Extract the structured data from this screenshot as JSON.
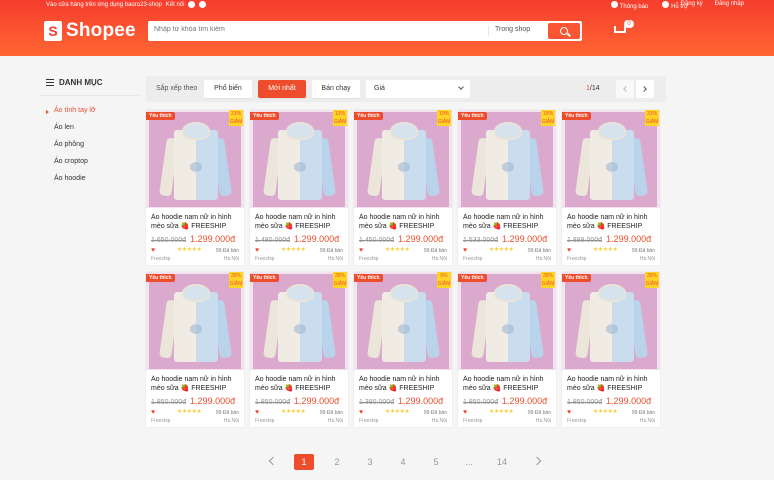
{
  "topbar": {
    "left_text": "Vào cửa hàng trên ứng dụng baoro23-shop",
    "connect": "Kết nối",
    "notifications": "Thông báo",
    "help": "Hỗ trợ",
    "register": "Đăng ký",
    "login": "Đăng nhập"
  },
  "header": {
    "logo_text": "Shopee",
    "search_placeholder": "Nhập từ khóa tìm kiếm",
    "search_scope": "Trong shop",
    "cart_count": "0"
  },
  "sidebar": {
    "title": "DANH MỤC",
    "items": [
      {
        "label": "Áo tình tay lỡ",
        "active": true
      },
      {
        "label": "Áo len"
      },
      {
        "label": "Áo phông"
      },
      {
        "label": "Áo croptop"
      },
      {
        "label": "Áo hoodie"
      }
    ]
  },
  "sortbar": {
    "label": "Sắp xếp theo",
    "options": [
      "Phổ biến",
      "Mới nhất",
      "Bán chạy"
    ],
    "active": "Mới nhất",
    "price_label": "Giá",
    "page_current": "1",
    "page_total": "/14"
  },
  "products": [
    {
      "name": "Áo hoodie nam nữ in hình mèo sữa 🍓 FREESHIP",
      "old_price": "1.650.000đ",
      "price": "1.299.000đ",
      "sold": "99 Đã bán",
      "badge": "Yêu thích",
      "discount": "21% GIẢM",
      "loc1": "Freeship",
      "loc2": "Hà Nội"
    },
    {
      "name": "Áo hoodie nam nữ in hình mèo sữa 🍓 FREESHIP",
      "old_price": "1.480.000đ",
      "price": "1.299.000đ",
      "sold": "99 Đã bán",
      "badge": "Yêu thích",
      "discount": "12% GIẢM",
      "loc1": "Freeship",
      "loc2": "Hà Nội"
    },
    {
      "name": "Áo hoodie nam nữ in hình mèo sữa 🍓 FREESHIP",
      "old_price": "1.450.000đ",
      "price": "1.299.000đ",
      "sold": "99 Đã bán",
      "badge": "Yêu thích",
      "discount": "10% GIẢM",
      "loc1": "Freeship",
      "loc2": "Hà Nội"
    },
    {
      "name": "Áo hoodie nam nữ in hình mèo sữa 🍓 FREESHIP",
      "old_price": "1.533.000đ",
      "price": "1.299.000đ",
      "sold": "99 Đã bán",
      "badge": "Yêu thích",
      "discount": "15% GIẢM",
      "loc1": "Freeship",
      "loc2": "Hà Nội"
    },
    {
      "name": "Áo hoodie nam nữ in hình mèo sữa 🍓 FREESHIP",
      "old_price": "1.888.000đ",
      "price": "1.299.000đ",
      "sold": "99 Đã bán",
      "badge": "Yêu thích",
      "discount": "31% GIẢM",
      "loc1": "Freeship",
      "loc2": "Hà Nội"
    },
    {
      "name": "Áo hoodie nam nữ in hình mèo sữa 🍓 FREESHIP",
      "old_price": "1.850.000đ",
      "price": "1.299.000đ",
      "sold": "99 Đã bán",
      "badge": "Yêu thích",
      "discount": "30% GIẢM",
      "loc1": "Freeship",
      "loc2": "Hà Nội"
    },
    {
      "name": "Áo hoodie nam nữ in hình mèo sữa 🍓 FREESHIP",
      "old_price": "1.850.000đ",
      "price": "1.299.000đ",
      "sold": "99 Đã bán",
      "badge": "Yêu thích",
      "discount": "30% GIẢM",
      "loc1": "Freeship",
      "loc2": "Hà Nội"
    },
    {
      "name": "Áo hoodie nam nữ in hình mèo sữa 🍓 FREESHIP",
      "old_price": "1.380.000đ",
      "price": "1.299.000đ",
      "sold": "99 Đã bán",
      "badge": "Yêu thích",
      "discount": "6% GIẢM",
      "loc1": "Freeship",
      "loc2": "Hà Nội"
    },
    {
      "name": "Áo hoodie nam nữ in hình mèo sữa 🍓 FREESHIP",
      "old_price": "1.850.000đ",
      "price": "1.299.000đ",
      "sold": "99 Đã bán",
      "badge": "Yêu thích",
      "discount": "30% GIẢM",
      "loc1": "Freeship",
      "loc2": "Hà Nội"
    },
    {
      "name": "Áo hoodie nam nữ in hình mèo sữa 🍓 FREESHIP",
      "old_price": "1.850.000đ",
      "price": "1.299.000đ",
      "sold": "99 Đã bán",
      "badge": "Yêu thích",
      "discount": "30% GIẢM",
      "loc1": "Freeship",
      "loc2": "Hà Nội"
    }
  ],
  "pagination": {
    "pages": [
      "1",
      "2",
      "3",
      "4",
      "5",
      "...",
      "14"
    ],
    "active": "1"
  },
  "colors": {
    "brand": "#ee4d2d",
    "header_gradient_top": "#f53d2d",
    "header_gradient_bottom": "#ff6633",
    "star": "#ffce3d"
  }
}
